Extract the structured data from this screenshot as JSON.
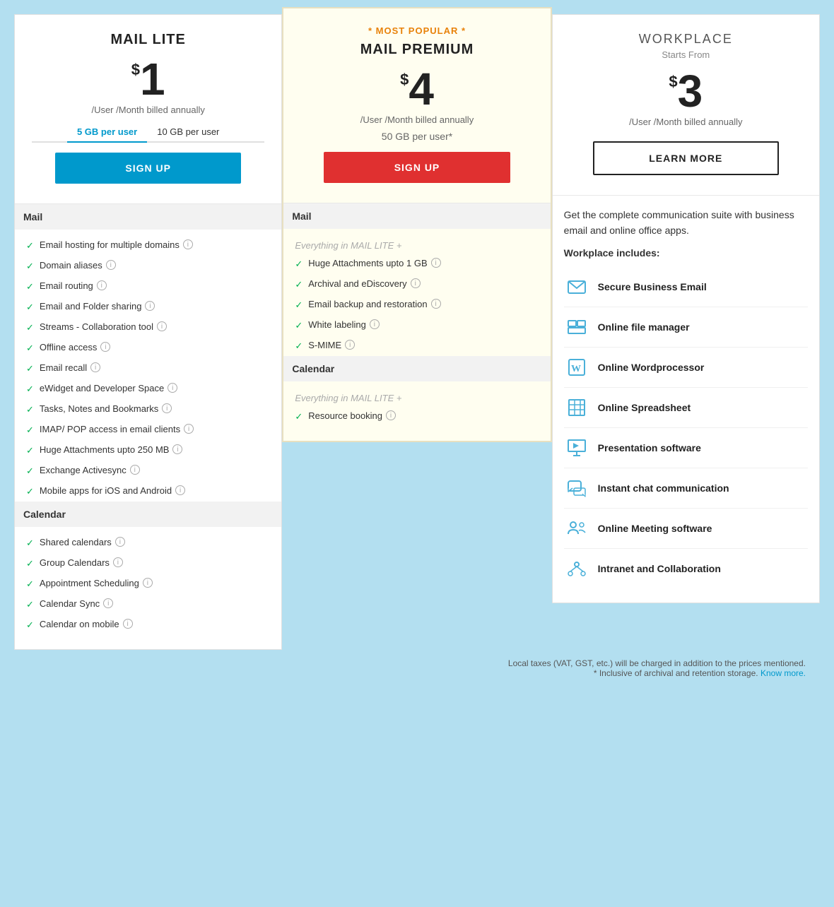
{
  "plans": {
    "lite": {
      "name": "MAIL LITE",
      "price": "1",
      "period": "/User /Month billed annually",
      "storage_tabs": [
        "5 GB per user",
        "10 GB per user"
      ],
      "active_tab": 0,
      "signup_label": "SIGN UP",
      "sections": {
        "mail": {
          "label": "Mail",
          "features": [
            "Email hosting for multiple domains",
            "Domain aliases",
            "Email routing",
            "Email and Folder sharing",
            "Streams - Collaboration tool",
            "Offline access",
            "Email recall",
            "eWidget and Developer Space",
            "Tasks, Notes and Bookmarks",
            "IMAP/ POP access in email clients",
            "Huge Attachments upto 250 MB",
            "Exchange Activesync",
            "Mobile apps for iOS and Android"
          ]
        },
        "calendar": {
          "label": "Calendar",
          "features": [
            "Shared calendars",
            "Group Calendars",
            "Appointment Scheduling",
            "Calendar Sync",
            "Calendar on mobile"
          ]
        }
      }
    },
    "premium": {
      "name": "MAIL PREMIUM",
      "badge": "* MOST POPULAR *",
      "price": "4",
      "period": "/User /Month billed annually",
      "storage": "50 GB per user*",
      "signup_label": "SIGN UP",
      "sections": {
        "mail": {
          "label": "Mail",
          "everything_in": "Everything in MAIL LITE +",
          "features": [
            "Huge Attachments upto 1 GB",
            "Archival and eDiscovery",
            "Email backup and restoration",
            "White labeling",
            "S-MIME"
          ]
        },
        "calendar": {
          "label": "Calendar",
          "everything_in": "Everything in MAIL LITE +",
          "features": [
            "Resource booking"
          ]
        }
      }
    },
    "workplace": {
      "name": "WORKPLACE",
      "starts_from": "Starts From",
      "price": "3",
      "period": "/User /Month billed annually",
      "learn_more_label": "LEARN MORE",
      "description": "Get the complete communication suite with business email and online office apps.",
      "includes_label": "Workplace includes:",
      "features": [
        {
          "icon": "email-icon",
          "label": "Secure Business Email"
        },
        {
          "icon": "file-manager-icon",
          "label": "Online file manager"
        },
        {
          "icon": "wordprocessor-icon",
          "label": "Online Wordprocessor"
        },
        {
          "icon": "spreadsheet-icon",
          "label": "Online Spreadsheet"
        },
        {
          "icon": "presentation-icon",
          "label": "Presentation software"
        },
        {
          "icon": "chat-icon",
          "label": "Instant chat communication"
        },
        {
          "icon": "meeting-icon",
          "label": "Online Meeting software"
        },
        {
          "icon": "intranet-icon",
          "label": "Intranet and Collaboration"
        }
      ]
    }
  },
  "footer": {
    "note1": "Local taxes (VAT, GST, etc.) will be charged in addition to the prices mentioned.",
    "note2": "* Inclusive of archival and retention storage.",
    "know_more": "Know more."
  }
}
